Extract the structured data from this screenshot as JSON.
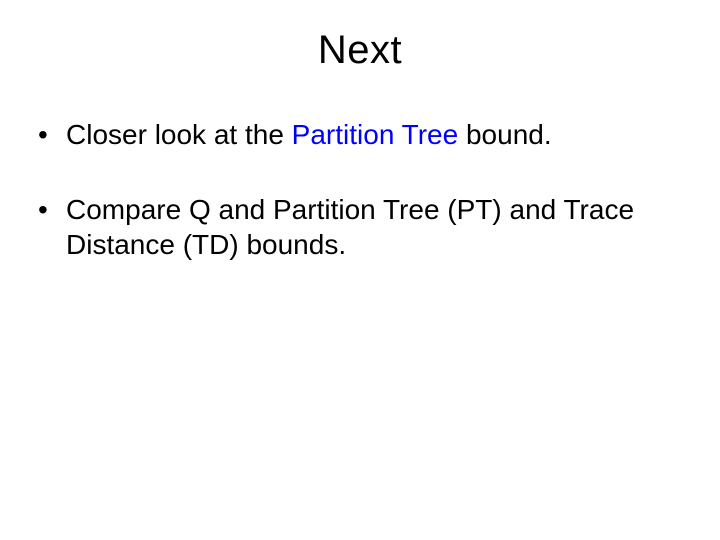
{
  "title": "Next",
  "bullets": [
    {
      "pre": "Closer look at the ",
      "blue": "Partition Tree",
      "post": " bound."
    },
    {
      "pre": "Compare Q and Partition Tree (PT) and Trace Distance (TD) bounds.",
      "blue": "",
      "post": ""
    }
  ]
}
